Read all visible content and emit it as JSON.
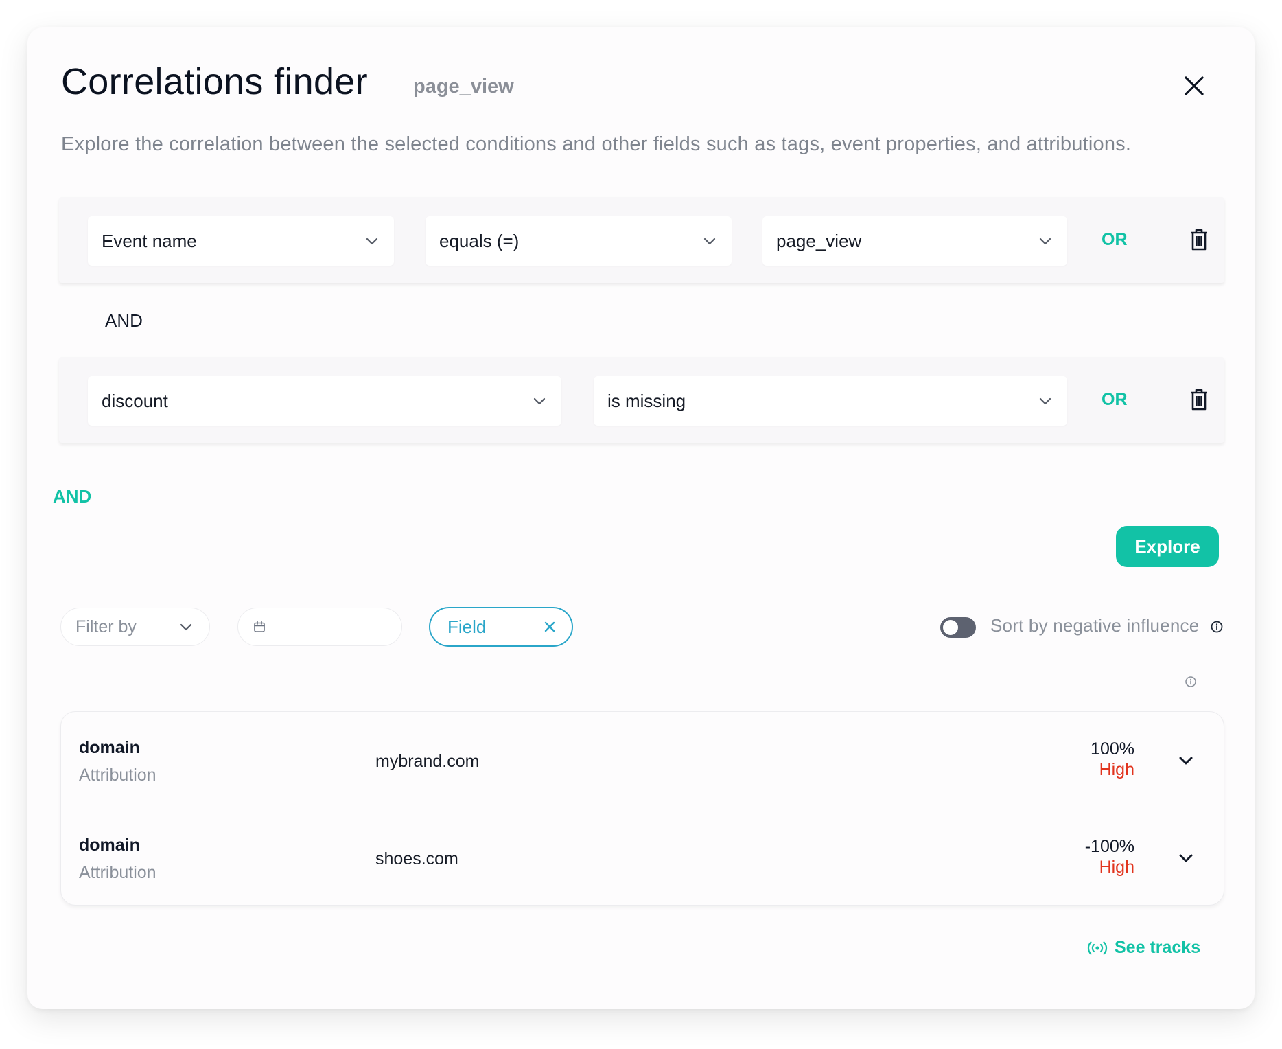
{
  "header": {
    "title": "Correlations finder",
    "event_tag": "page_view",
    "description": "Explore the correlation between the selected conditions and other fields such as tags, event properties, and attributions."
  },
  "conditions": [
    {
      "field": "Event name",
      "operator": "equals (=)",
      "value": "page_view",
      "or_label": "OR"
    },
    {
      "field": "discount",
      "operator": "is missing",
      "or_label": "OR"
    }
  ],
  "and_label": "AND",
  "and_add_label": "AND",
  "explore_label": "Explore",
  "filters": {
    "filter_by_placeholder": "Filter by",
    "date_value": "",
    "field_chip": "Field",
    "sort_toggle_label": "Sort by negative influence",
    "sort_toggle_on": false
  },
  "results": [
    {
      "field": "domain",
      "category": "Attribution",
      "value": "mybrand.com",
      "correlation": "100%",
      "level": "High"
    },
    {
      "field": "domain",
      "category": "Attribution",
      "value": "shoes.com",
      "correlation": "-100%",
      "level": "High"
    }
  ],
  "see_tracks_label": "See tracks",
  "colors": {
    "accent": "#12c2a6",
    "chip_border": "#2aa6c9",
    "level_high": "#e1341e"
  },
  "icons": {
    "close": "close-icon",
    "chevron": "chevron-down-icon",
    "trash": "trash-icon",
    "calendar": "calendar-icon",
    "info": "info-icon",
    "tracks": "broadcast-icon"
  }
}
